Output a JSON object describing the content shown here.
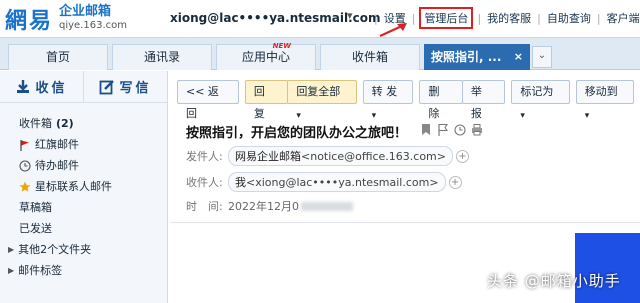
{
  "header": {
    "logo_mark": "網易",
    "logo_title": "企业邮箱",
    "logo_sub": "qiye.163.com",
    "account_email": "xiong@lac••••ya.ntesmail.com",
    "nav": [
      "设置",
      "管理后台",
      "我的客服",
      "自助查询",
      "客户端"
    ],
    "highlighted_nav": "管理后台"
  },
  "tabs": [
    {
      "label": "首页"
    },
    {
      "label": "通讯录"
    },
    {
      "label": "应用中心",
      "badge": "NEW"
    },
    {
      "label": "收件箱"
    },
    {
      "label": "按照指引, ...",
      "active": true,
      "close": "×"
    }
  ],
  "sidebar": {
    "receive": "收信",
    "write": "写信",
    "folders": [
      {
        "label": "收件箱",
        "count": "(2)"
      },
      {
        "label": "红旗邮件",
        "icon": "red-flag-icon"
      },
      {
        "label": "待办邮件",
        "icon": "clock-icon"
      },
      {
        "label": "星标联系人邮件",
        "icon": "star-icon"
      },
      {
        "label": "草稿箱"
      },
      {
        "label": "已发送"
      },
      {
        "label": "其他2个文件夹",
        "expandable": true
      },
      {
        "label": "邮件标签",
        "expandable": true
      }
    ]
  },
  "toolbar": {
    "back": "<< 返回",
    "reply": "回 复",
    "reply_all": "回复全部",
    "forward": "转 发",
    "delete": "删 除",
    "report": "举 报",
    "mark_as": "标记为",
    "move_to": "移动到"
  },
  "mail": {
    "subject": "按照指引，开启您的团队办公之旅吧！",
    "sender_label": "发件人:",
    "sender_name": "网易企业邮箱",
    "sender_addr": "<notice@office.163.com>",
    "recipient_label": "收件人:",
    "recipient_name": "我",
    "recipient_addr": "<xiong@lac••••ya.ntesmail.com>",
    "time_label": "时　间:",
    "time_value": "2022年12月0"
  },
  "watermark": "头条 @邮箱小助手",
  "colors": {
    "accent": "#2b6cb0",
    "highlight": "#e02020",
    "brand": "#1a73c9"
  }
}
